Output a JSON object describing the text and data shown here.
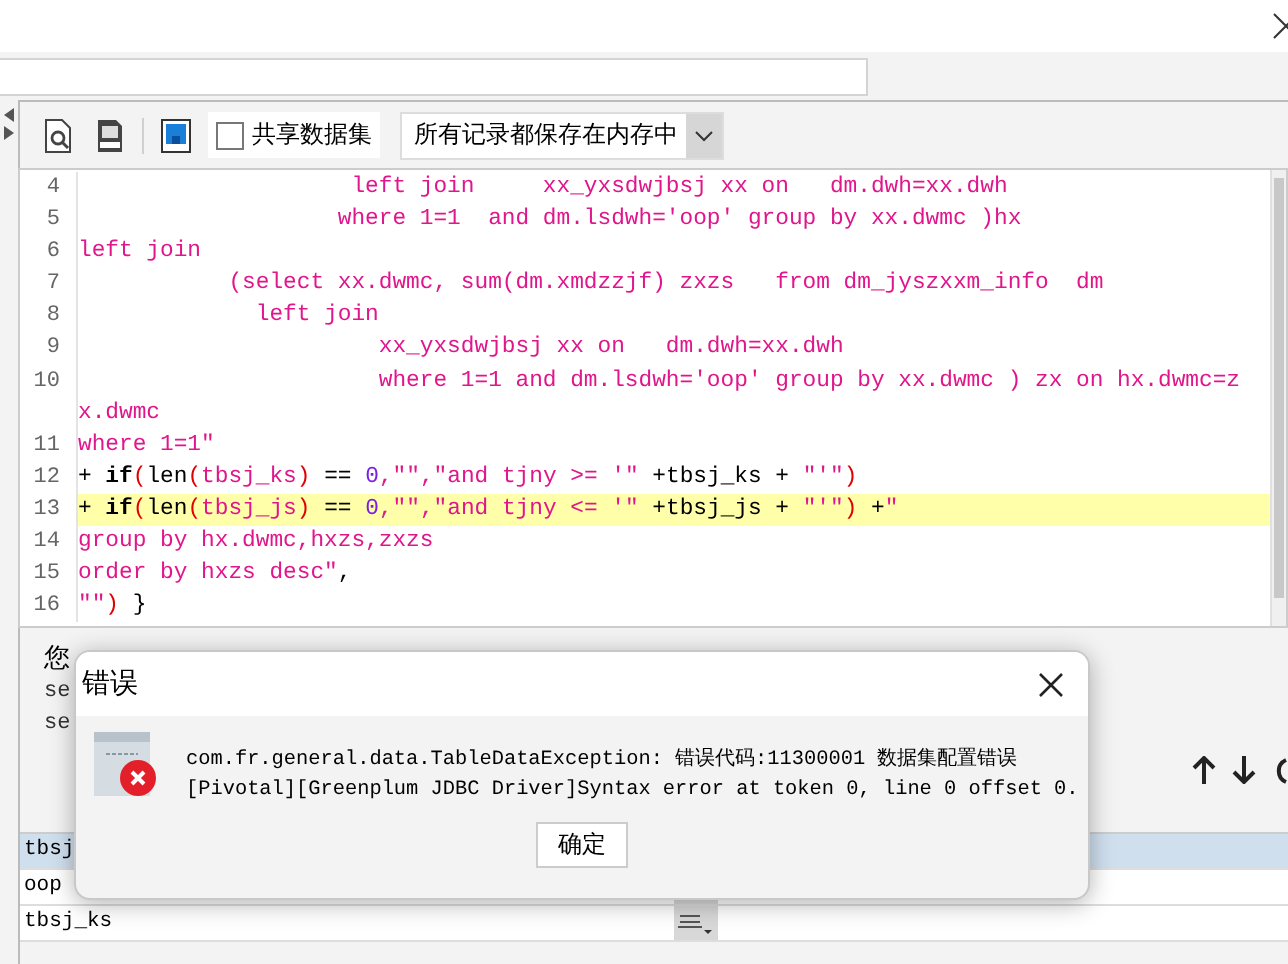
{
  "toolbar": {
    "share_checkbox": {
      "label": "共享数据集",
      "checked": false
    },
    "cache_select": {
      "value": "所有记录都保存在内存中"
    }
  },
  "editor": {
    "lines": [
      {
        "number": "4",
        "highlighted": false,
        "segments": [
          {
            "kind": "str",
            "text": "                    left join     xx_yxsdwjbsj xx on   dm.dwh=xx.dwh"
          }
        ]
      },
      {
        "number": "5",
        "highlighted": false,
        "segments": [
          {
            "kind": "str",
            "text": "                   where 1=1  and dm.lsdwh='oop' group by xx.dwmc )hx"
          }
        ]
      },
      {
        "number": "6",
        "highlighted": false,
        "segments": [
          {
            "kind": "str",
            "text": "left join"
          }
        ]
      },
      {
        "number": "7",
        "highlighted": false,
        "segments": [
          {
            "kind": "str",
            "text": "           (select xx.dwmc, sum(dm.xmdzzjf) zxzs   from dm_jyszxxm_info  dm"
          }
        ]
      },
      {
        "number": "8",
        "highlighted": false,
        "segments": [
          {
            "kind": "str",
            "text": "             left join"
          }
        ]
      },
      {
        "number": "9",
        "highlighted": false,
        "segments": [
          {
            "kind": "str",
            "text": "                      xx_yxsdwjbsj xx on   dm.dwh=xx.dwh"
          }
        ]
      },
      {
        "number": "10",
        "highlighted": false,
        "segments": [
          {
            "kind": "str",
            "text": "                      where 1=1 and dm.lsdwh='oop' group by xx.dwmc ) zx on hx.dwmc=z"
          }
        ]
      },
      {
        "continuation": true,
        "highlighted": false,
        "segments": [
          {
            "kind": "str",
            "text": "x.dwmc"
          }
        ]
      },
      {
        "number": "11",
        "highlighted": false,
        "segments": [
          {
            "kind": "str",
            "text": "where 1=1\""
          }
        ]
      },
      {
        "number": "12",
        "highlighted": false,
        "segments": [
          {
            "kind": "plain",
            "text": "+ "
          },
          {
            "kind": "keyword",
            "text": "if"
          },
          {
            "kind": "paren",
            "text": "("
          },
          {
            "kind": "plain",
            "text": "len"
          },
          {
            "kind": "paren",
            "text": "("
          },
          {
            "kind": "str",
            "text": "tbsj_ks"
          },
          {
            "kind": "paren",
            "text": ")"
          },
          {
            "kind": "plain",
            "text": " == "
          },
          {
            "kind": "num",
            "text": "0"
          },
          {
            "kind": "str",
            "text": ",\"\",\"and tjny >= '\""
          },
          {
            "kind": "plain",
            "text": " +tbsj_ks + "
          },
          {
            "kind": "str",
            "text": "\"'\""
          },
          {
            "kind": "paren",
            "text": ")"
          }
        ]
      },
      {
        "number": "13",
        "highlighted": true,
        "segments": [
          {
            "kind": "plain",
            "text": "+ "
          },
          {
            "kind": "keyword",
            "text": "if"
          },
          {
            "kind": "paren",
            "text": "("
          },
          {
            "kind": "plain",
            "text": "len"
          },
          {
            "kind": "paren",
            "text": "("
          },
          {
            "kind": "str",
            "text": "tbsj_js"
          },
          {
            "kind": "paren",
            "text": ")"
          },
          {
            "kind": "plain",
            "text": " == "
          },
          {
            "kind": "num",
            "text": "0"
          },
          {
            "kind": "str",
            "text": ",\"\",\"and tjny <= '\""
          },
          {
            "kind": "plain",
            "text": " +tbsj_js + "
          },
          {
            "kind": "str",
            "text": "\"'\""
          },
          {
            "kind": "paren",
            "text": ")"
          },
          {
            "kind": "plain",
            "text": " +"
          },
          {
            "kind": "str",
            "text": "\""
          }
        ]
      },
      {
        "number": "14",
        "highlighted": false,
        "segments": [
          {
            "kind": "str",
            "text": "group by hx.dwmc,hxzs,zxzs"
          }
        ]
      },
      {
        "number": "15",
        "highlighted": false,
        "segments": [
          {
            "kind": "str",
            "text": "order by hxzs desc\""
          },
          {
            "kind": "plain",
            "text": ","
          }
        ]
      },
      {
        "number": "16",
        "highlighted": false,
        "segments": [
          {
            "kind": "str",
            "text": "\"\""
          },
          {
            "kind": "paren",
            "text": ")"
          },
          {
            "kind": "plain",
            "text": " }"
          }
        ]
      }
    ]
  },
  "hint": {
    "text": "您",
    "lines": [
      "se",
      "se"
    ]
  },
  "parameters": {
    "rows": [
      {
        "name": "tbsj",
        "selected": true
      },
      {
        "name": "oop",
        "selected": false
      },
      {
        "name": "tbsj_ks",
        "selected": false
      }
    ]
  },
  "dialog": {
    "title": "错误",
    "message_lines": [
      "com.fr.general.data.TableDataException: 错误代码:11300001 数据集配置错误",
      "[Pivotal][Greenplum JDBC Driver]Syntax error at token 0, line 0 offset 0."
    ],
    "button": "确定"
  }
}
